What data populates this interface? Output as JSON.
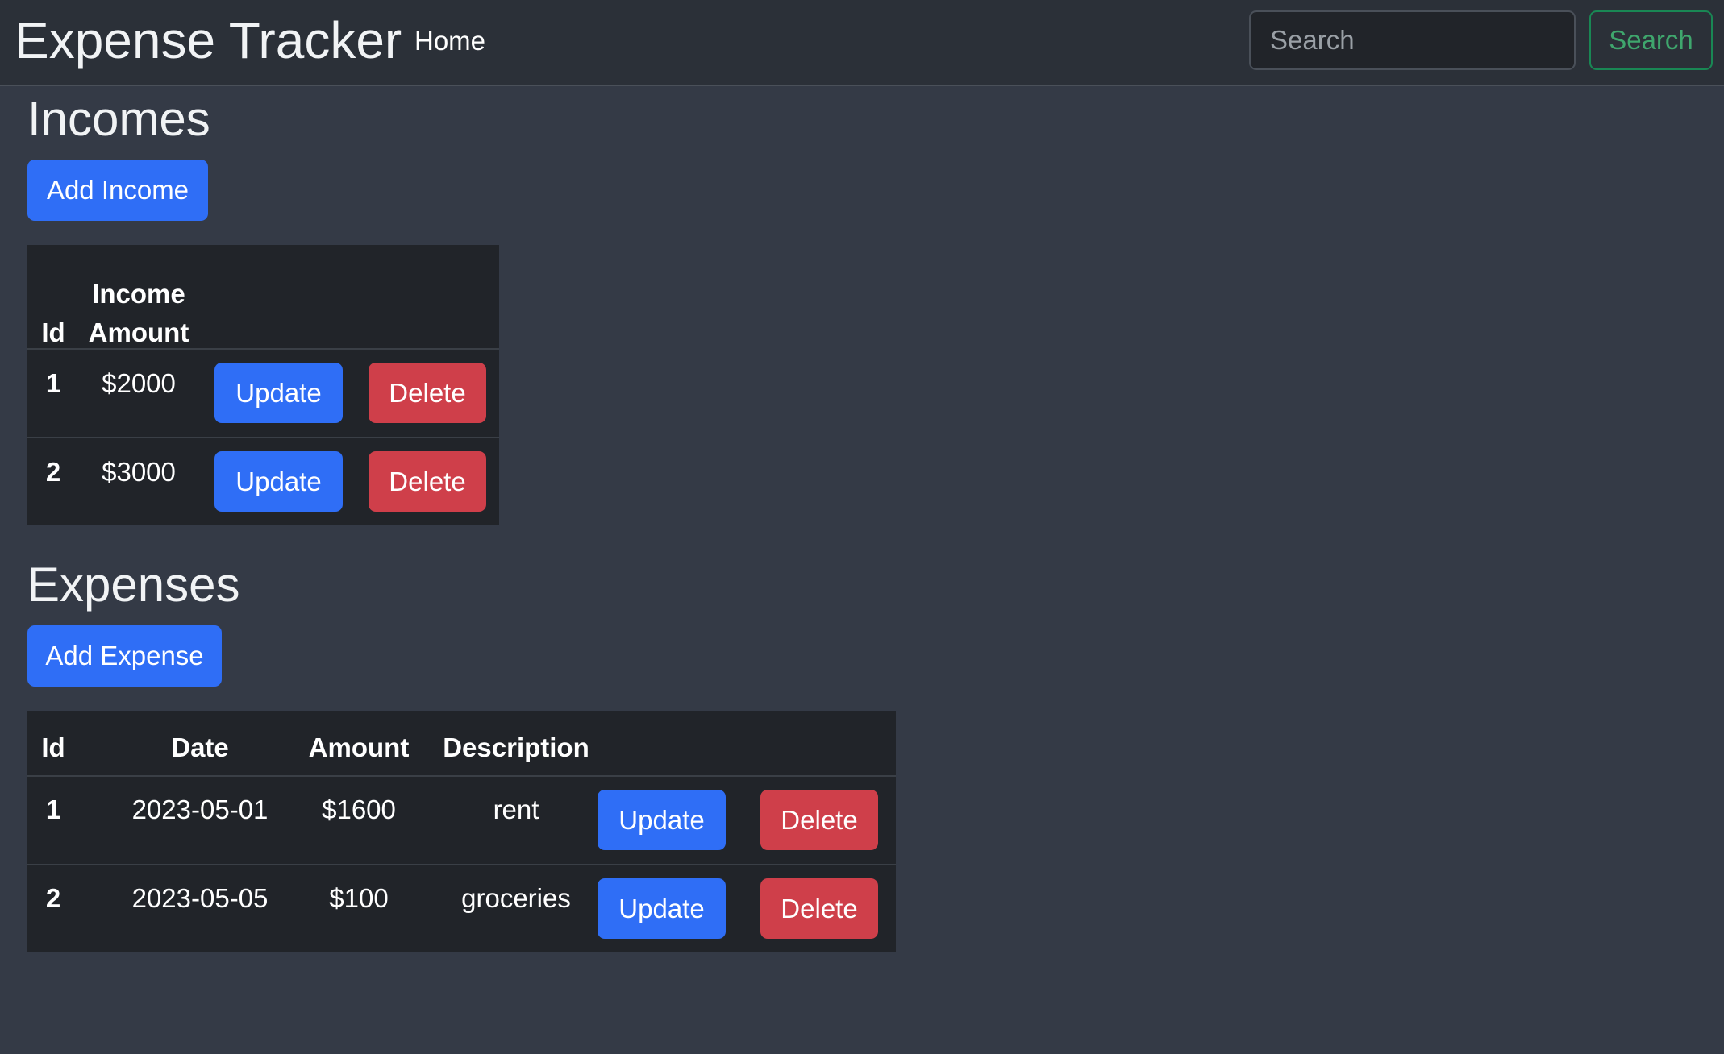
{
  "navbar": {
    "brand": "Expense Tracker",
    "home_link": "Home",
    "search_placeholder": "Search",
    "search_button": "Search"
  },
  "incomes": {
    "title": "Incomes",
    "add_button": "Add Income",
    "columns": [
      "Id",
      "Income",
      "Amount"
    ],
    "rows": [
      {
        "id": "1",
        "amount": "$2000",
        "update": "Update",
        "delete": "Delete"
      },
      {
        "id": "2",
        "amount": "$3000",
        "update": "Update",
        "delete": "Delete"
      }
    ]
  },
  "expenses": {
    "title": "Expenses",
    "add_button": "Add Expense",
    "columns": [
      "Id",
      "Date",
      "Amount",
      "Description"
    ],
    "rows": [
      {
        "id": "1",
        "date": "2023-05-01",
        "amount": "$1600",
        "description": "rent",
        "update": "Update",
        "delete": "Delete"
      },
      {
        "id": "2",
        "date": "2023-05-05",
        "amount": "$100",
        "description": "groceries",
        "update": "Update",
        "delete": "Delete"
      }
    ]
  },
  "colors": {
    "background": "#343a46",
    "navbar": "#2b3038",
    "table": "#212429",
    "primary": "#2f6ef6",
    "danger": "#cf3f4a",
    "success": "#198754"
  }
}
